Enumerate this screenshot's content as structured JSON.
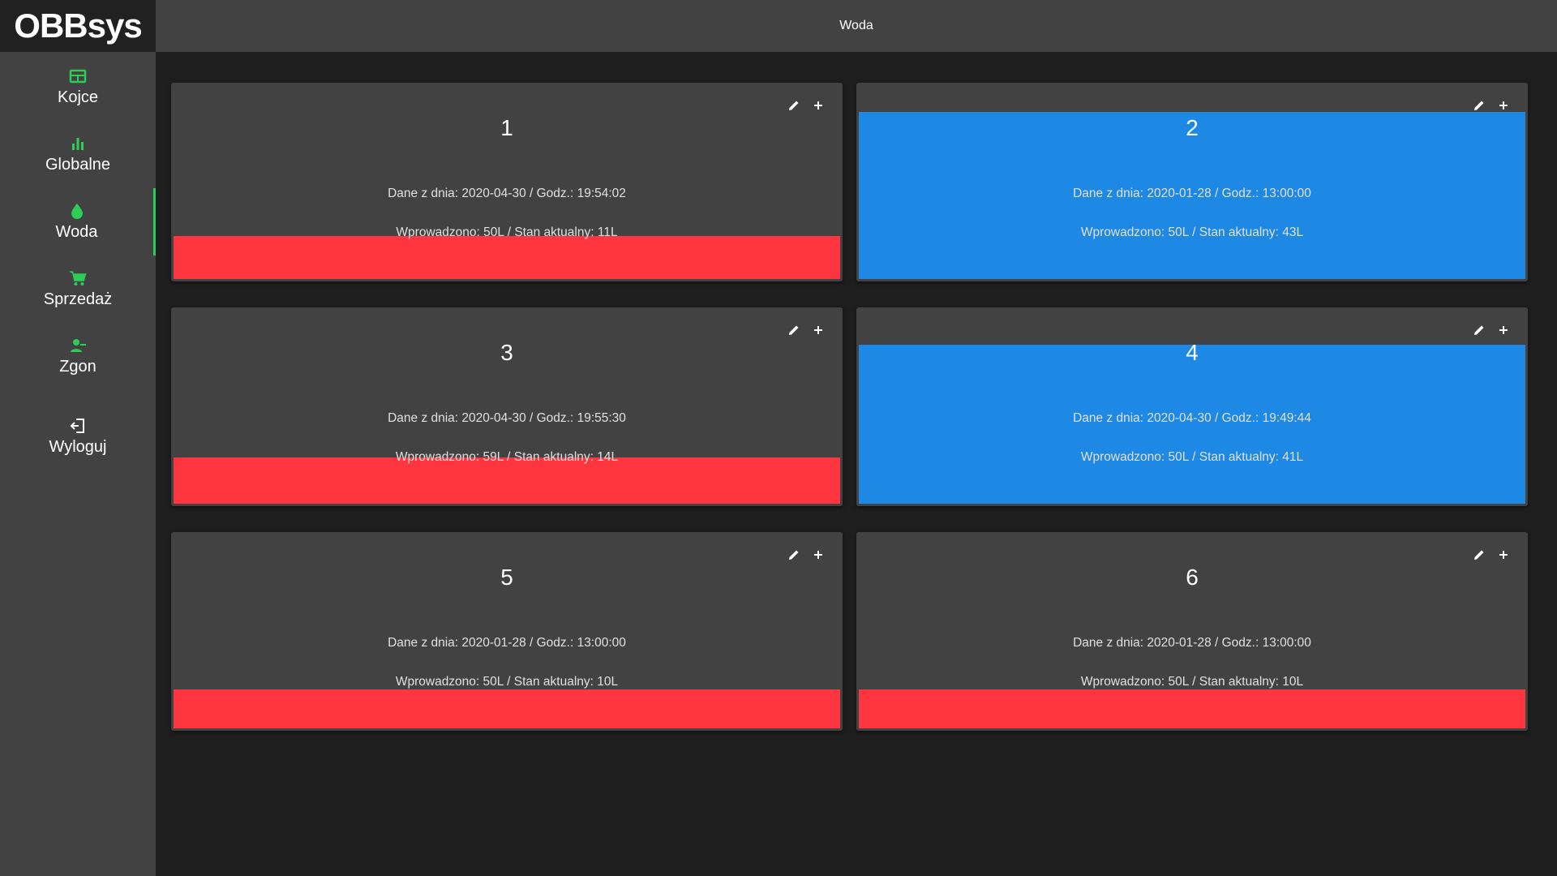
{
  "app": {
    "logo": "OBBsys",
    "page_title": "Woda"
  },
  "colors": {
    "accent": "#2ecc57",
    "low": "#ff363f",
    "ok": "#1e88e5"
  },
  "sidebar": {
    "items": [
      {
        "label": "Kojce",
        "icon": "pen-grid-icon"
      },
      {
        "label": "Globalne",
        "icon": "bar-chart-icon"
      },
      {
        "label": "Woda",
        "icon": "water-drop-icon",
        "active": true
      },
      {
        "label": "Sprzedaż",
        "icon": "shopping-cart-icon"
      },
      {
        "label": "Zgon",
        "icon": "person-remove-icon"
      },
      {
        "label": "Wyloguj",
        "icon": "logout-icon"
      }
    ]
  },
  "cards": [
    {
      "number": "1",
      "date_line": "Dane z dnia: 2020-04-30 / Godz.: 19:54:02",
      "amount_line": "Wprowadzono: 50L / Stan aktualny: 11L",
      "status": "low",
      "level": 0.22
    },
    {
      "number": "2",
      "date_line": "Dane z dnia: 2020-01-28 / Godz.: 13:00:00",
      "amount_line": "Wprowadzono: 50L / Stan aktualny: 43L",
      "status": "ok",
      "level": 0.86
    },
    {
      "number": "3",
      "date_line": "Dane z dnia: 2020-04-30 / Godz.: 19:55:30",
      "amount_line": "Wprowadzono: 59L / Stan aktualny: 14L",
      "status": "low",
      "level": 0.24
    },
    {
      "number": "4",
      "date_line": "Dane z dnia: 2020-04-30 / Godz.: 19:49:44",
      "amount_line": "Wprowadzono: 50L / Stan aktualny: 41L",
      "status": "ok",
      "level": 0.82
    },
    {
      "number": "5",
      "date_line": "Dane z dnia: 2020-01-28 / Godz.: 13:00:00",
      "amount_line": "Wprowadzono: 50L / Stan aktualny: 10L",
      "status": "low",
      "level": 0.2
    },
    {
      "number": "6",
      "date_line": "Dane z dnia: 2020-01-28 / Godz.: 13:00:00",
      "amount_line": "Wprowadzono: 50L / Stan aktualny: 10L",
      "status": "low",
      "level": 0.2
    }
  ]
}
